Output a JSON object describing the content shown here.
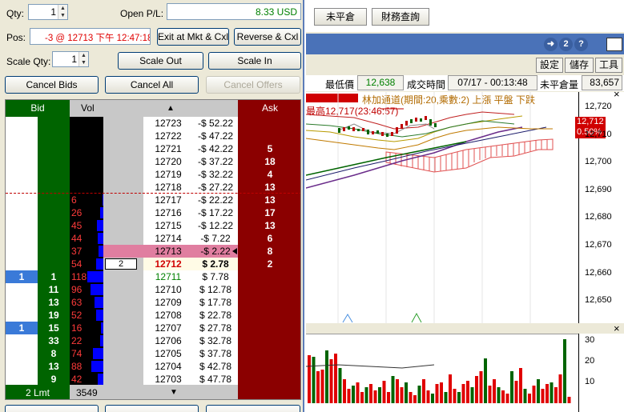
{
  "order_panel": {
    "qty_label": "Qty:",
    "qty_value": "1",
    "open_pl_label": "Open P/L:",
    "open_pl_value": "8.33 USD",
    "pos_label": "Pos:",
    "pos_value": "-3 @ 12713 下午 12:47:18",
    "exit_button": "Exit at Mkt & Cxl",
    "reverse_button": "Reverse & Cxl",
    "scale_qty_label": "Scale Qty:",
    "scale_qty_value": "1",
    "scale_out_button": "Scale Out",
    "scale_in_button": "Scale In",
    "cancel_bids_button": "Cancel Bids",
    "cancel_all_button": "Cancel All",
    "cancel_offers_button": "Cancel Offers"
  },
  "ladder": {
    "header_bid": "Bid",
    "header_vol": "Vol",
    "header_up": "▲",
    "header_ask": "Ask",
    "footer_lmt": "2 Lmt",
    "footer_volume": "3549",
    "footer_down": "▼",
    "order_qty": "2",
    "rows": [
      {
        "price": "12723",
        "pl": "-$ 52.22",
        "ask": "",
        "bid": "",
        "bidq": "",
        "vol": "",
        "volfrac": 0
      },
      {
        "price": "12722",
        "pl": "-$ 47.22",
        "ask": "",
        "bid": "",
        "bidq": "",
        "vol": "",
        "volfrac": 0
      },
      {
        "price": "12721",
        "pl": "-$ 42.22",
        "ask": "5",
        "bid": "",
        "bidq": "",
        "vol": "",
        "volfrac": 0
      },
      {
        "price": "12720",
        "pl": "-$ 37.22",
        "ask": "18",
        "bid": "",
        "bidq": "",
        "vol": "",
        "volfrac": 0
      },
      {
        "price": "12719",
        "pl": "-$ 32.22",
        "ask": "4",
        "bid": "",
        "bidq": "",
        "vol": "",
        "volfrac": 0
      },
      {
        "price": "12718",
        "pl": "-$ 27.22",
        "ask": "13",
        "bid": "",
        "bidq": "",
        "vol": "",
        "volfrac": 0
      },
      {
        "price": "12717",
        "pl": "-$ 22.22",
        "ask": "13",
        "bid": "",
        "bidq": "",
        "vol": "6",
        "volfrac": 0.05
      },
      {
        "price": "12716",
        "pl": "-$ 17.22",
        "ask": "17",
        "bid": "",
        "bidq": "",
        "vol": "26",
        "volfrac": 0.22
      },
      {
        "price": "12715",
        "pl": "-$ 12.22",
        "ask": "13",
        "bid": "",
        "bidq": "",
        "vol": "45",
        "volfrac": 0.38
      },
      {
        "price": "12714",
        "pl": "-$ 7.22",
        "ask": "6",
        "bid": "",
        "bidq": "",
        "vol": "44",
        "volfrac": 0.37
      },
      {
        "price": "12713",
        "pl": "-$ 2.22",
        "ask": "8",
        "bid": "",
        "bidq": "",
        "vol": "37",
        "volfrac": 0.31
      },
      {
        "price": "12712",
        "pl": "$ 2.78",
        "ask": "2",
        "bid": "",
        "bidq": "",
        "vol": "54",
        "volfrac": 0.46
      },
      {
        "price": "12711",
        "pl": "$ 7.78",
        "ask": "",
        "bid": "1",
        "bidq": "1",
        "vol": "118",
        "volfrac": 1.0
      },
      {
        "price": "12710",
        "pl": "$ 12.78",
        "ask": "",
        "bid": "",
        "bidq": "11",
        "vol": "96",
        "volfrac": 0.81
      },
      {
        "price": "12709",
        "pl": "$ 17.78",
        "ask": "",
        "bid": "",
        "bidq": "13",
        "vol": "63",
        "volfrac": 0.53
      },
      {
        "price": "12708",
        "pl": "$ 22.78",
        "ask": "",
        "bid": "",
        "bidq": "19",
        "vol": "52",
        "volfrac": 0.44
      },
      {
        "price": "12707",
        "pl": "$ 27.78",
        "ask": "",
        "bid": "1",
        "bidq": "15",
        "vol": "16",
        "volfrac": 0.14
      },
      {
        "price": "12706",
        "pl": "$ 32.78",
        "ask": "",
        "bid": "",
        "bidq": "33",
        "vol": "22",
        "volfrac": 0.19
      },
      {
        "price": "12705",
        "pl": "$ 37.78",
        "ask": "",
        "bid": "",
        "bidq": "8",
        "vol": "74",
        "volfrac": 0.63
      },
      {
        "price": "12704",
        "pl": "$ 42.78",
        "ask": "",
        "bid": "",
        "bidq": "13",
        "vol": "88",
        "volfrac": 0.75
      },
      {
        "price": "12703",
        "pl": "$ 47.78",
        "ask": "",
        "bid": "",
        "bidq": "9",
        "vol": "42",
        "volfrac": 0.36
      },
      {
        "price": "12702",
        "pl": "$ 52.78",
        "ask": "",
        "bid": "",
        "bidq": "4",
        "vol": "78",
        "volfrac": 0.66
      }
    ]
  },
  "chart_panel": {
    "tab_uncovered": "未平倉",
    "tab_finance": "財務查詢",
    "btn_settings": "設定",
    "btn_save": "儲存",
    "btn_tools": "工具",
    "quote": {
      "low_label": "最低價",
      "low_value": "12,638",
      "time_label": "成交時間",
      "time_value": "07/17 - 00:13:48",
      "oi_label": "未平倉量",
      "oi_value": "83,657"
    },
    "indicator_label": "林加通道(期間:20,乘數:2) 上漲  平盤  下跌",
    "high_annotation": "最高12,717(23:46:57)",
    "last_price": "12,712",
    "last_change": "0.50%",
    "help_num": "2",
    "help_q": "?",
    "price_ticks": [
      "12,720",
      "12,710",
      "12,700",
      "12,690",
      "12,680",
      "12,670",
      "12,660",
      "12,650"
    ],
    "volume_ticks": [
      "30",
      "20",
      "10"
    ],
    "close_icon": "×"
  }
}
